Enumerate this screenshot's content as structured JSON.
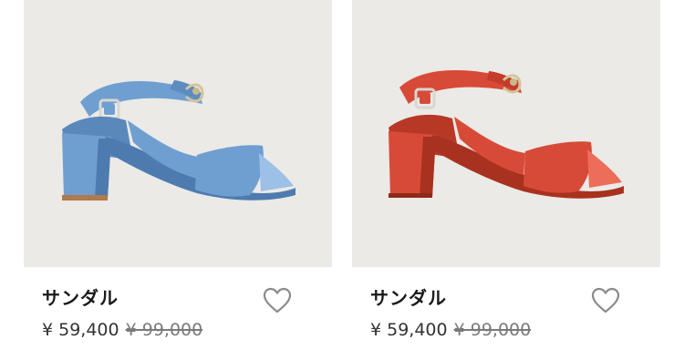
{
  "products": [
    {
      "name": "サンダル",
      "price": "¥ 59,400",
      "original_price": "¥ 99,000",
      "color": "#6f9fd1",
      "color_dark": "#4d7bb0",
      "color_light": "#9cc0e6",
      "favorite_icon": "heart-outline-icon"
    },
    {
      "name": "サンダル",
      "price": "¥ 59,400",
      "original_price": "¥ 99,000",
      "color": "#d84a38",
      "color_dark": "#a8321f",
      "color_light": "#ec6d58",
      "favorite_icon": "heart-outline-icon"
    }
  ],
  "image_bg": "#ebeae7"
}
